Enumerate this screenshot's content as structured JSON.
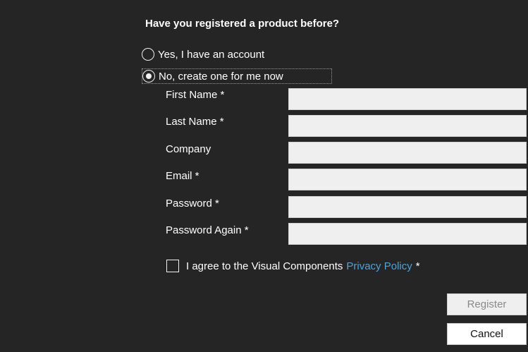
{
  "question": "Have you registered a product before?",
  "options": {
    "yes_label": "Yes, I have an account",
    "no_label": "No, create one for me now",
    "selected": "no"
  },
  "fields": [
    {
      "label": "First Name *",
      "value": ""
    },
    {
      "label": "Last Name *",
      "value": ""
    },
    {
      "label": "Company",
      "value": ""
    },
    {
      "label": "Email *",
      "value": ""
    },
    {
      "label": "Password *",
      "value": ""
    },
    {
      "label": "Password Again *",
      "value": ""
    }
  ],
  "agreement": {
    "text": "I agree to the Visual Components",
    "link_text": "Privacy Policy",
    "required_mark": "*",
    "checked": false
  },
  "buttons": {
    "register": "Register",
    "cancel": "Cancel"
  },
  "colors": {
    "background": "#252526",
    "link": "#4ea3d8",
    "input_bg": "#efefef"
  }
}
